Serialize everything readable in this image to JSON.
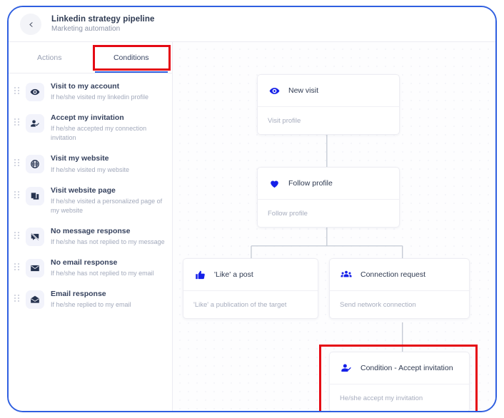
{
  "header": {
    "back_icon": "chevron-left-icon",
    "title": "Linkedin strategy pipeline",
    "subtitle": "Marketing automation"
  },
  "sidebar": {
    "tabs": [
      {
        "label": "Actions",
        "active": false
      },
      {
        "label": "Conditions",
        "active": true
      }
    ],
    "conditions": [
      {
        "icon": "eye-icon",
        "title": "Visit to my account",
        "desc": "If he/she visited my linkedin profile"
      },
      {
        "icon": "user-check-icon",
        "title": "Accept my invitation",
        "desc": "If he/she accepted my connection invitation"
      },
      {
        "icon": "globe-icon",
        "title": "Visit my website",
        "desc": "If he/she visited my website"
      },
      {
        "icon": "pages-icon",
        "title": "Visit website page",
        "desc": "If he/she visited a personalized page of my website"
      },
      {
        "icon": "no-message-icon",
        "title": "No message response",
        "desc": "If he/she has not replied to my message"
      },
      {
        "icon": "envelope-icon",
        "title": "No email response",
        "desc": "If he/she has not replied to my email"
      },
      {
        "icon": "envelope-open-icon",
        "title": "Email response",
        "desc": "If he/she replied to my email"
      }
    ]
  },
  "canvas": {
    "delete_icon": "trash-icon",
    "nodes": [
      {
        "id": "new-visit",
        "icon": "eye-icon",
        "title": "New visit",
        "desc": "Visit profile"
      },
      {
        "id": "follow-profile",
        "icon": "heart-icon",
        "title": "Follow profile",
        "desc": "Follow profile"
      },
      {
        "id": "like-a-post",
        "icon": "thumbs-up-icon",
        "title": "'Like' a post",
        "desc": "'Like' a publication of the target"
      },
      {
        "id": "connection-request",
        "icon": "people-group-icon",
        "title": "Connection request",
        "desc": "Send network connection"
      },
      {
        "id": "condition-accept-invitation",
        "icon": "user-check-icon",
        "title": "Condition - Accept invitation",
        "desc": "He/she accept my invitation"
      }
    ]
  },
  "colors": {
    "frame_border": "#2f5fe0",
    "annotation": "#e50914",
    "node_icon": "#1520e8",
    "trash": "#f60e14",
    "tab_active_underline": "#2f5fe0"
  }
}
